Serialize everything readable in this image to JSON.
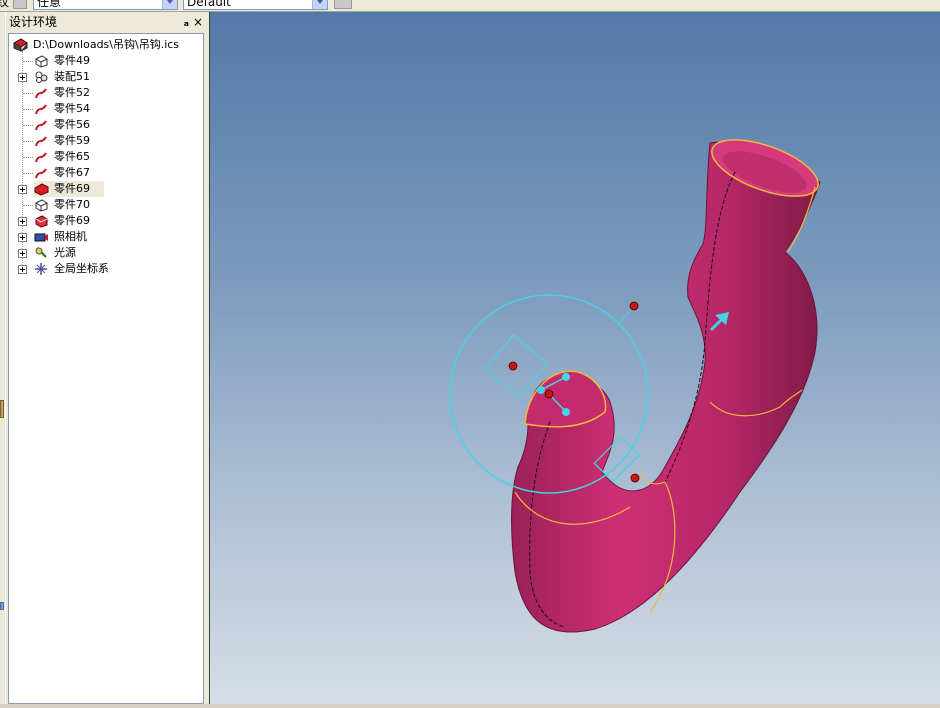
{
  "toolbar": {
    "left_partial": "纹",
    "combo1": "任意",
    "combo2": "Default"
  },
  "panel": {
    "title": "设计环境",
    "pin_glyph": "ₐ",
    "close_glyph": "×"
  },
  "tree": {
    "root": "D:\\Downloads\\吊钩\\吊钩.ics",
    "items": [
      {
        "label": "零件49",
        "icon": "part-box-icon",
        "expandable": false
      },
      {
        "label": "装配51",
        "icon": "assembly-icon",
        "expandable": true
      },
      {
        "label": "零件52",
        "icon": "sketch-curve-icon",
        "expandable": false
      },
      {
        "label": "零件54",
        "icon": "sketch-curve-icon",
        "expandable": false
      },
      {
        "label": "零件56",
        "icon": "sketch-curve-icon",
        "expandable": false
      },
      {
        "label": "零件59",
        "icon": "sketch-curve-icon",
        "expandable": false
      },
      {
        "label": "零件65",
        "icon": "sketch-curve-icon",
        "expandable": false
      },
      {
        "label": "零件67",
        "icon": "sketch-curve-icon",
        "expandable": false
      },
      {
        "label": "零件69",
        "icon": "red-part-icon",
        "expandable": true,
        "selected": true
      },
      {
        "label": "零件70",
        "icon": "part-box-icon",
        "expandable": false
      },
      {
        "label": "零件69",
        "icon": "red-solid-icon",
        "expandable": true
      },
      {
        "label": "照相机",
        "icon": "camera-icon",
        "expandable": true
      },
      {
        "label": "光源",
        "icon": "light-icon",
        "expandable": true
      },
      {
        "label": "全局坐标系",
        "icon": "coordinate-system-icon",
        "expandable": true
      }
    ]
  },
  "colors": {
    "model": "#c42a6c",
    "model_dark": "#8e1f50",
    "edge": "#f2b83a",
    "gizmo": "#45d4e6",
    "handle": "#cc1414"
  }
}
